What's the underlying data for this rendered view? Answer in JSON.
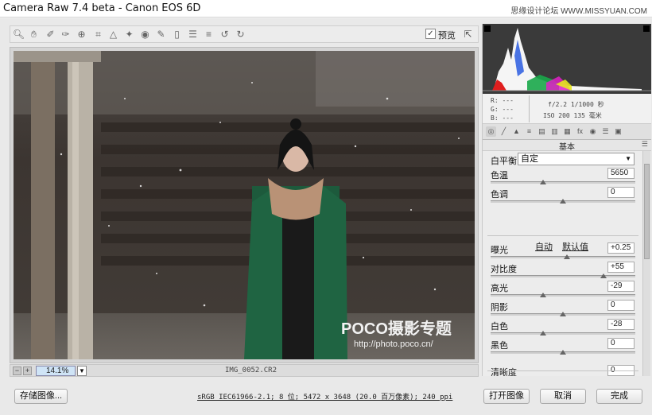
{
  "window": {
    "title": "Camera Raw 7.4 beta -  Canon EOS 6D",
    "watermark": "思缘设计论坛  WWW.MISSYUAN.COM"
  },
  "toolbar": {
    "tools": [
      "zoom-icon",
      "hand-icon",
      "white-balance-icon",
      "color-sampler-icon",
      "target-adjust-icon",
      "crop-icon",
      "straighten-icon",
      "spot-removal-icon",
      "red-eye-icon",
      "adjustment-brush-icon",
      "graduated-filter-icon",
      "radial-filter-icon",
      "preferences-icon",
      "rotate-ccw-icon",
      "rotate-cw-icon"
    ],
    "preview_label": "预览",
    "preview_checked": true
  },
  "image": {
    "watermark_brand": "POCO摄影专题",
    "watermark_url": "http://photo.poco.cn/"
  },
  "zoom": {
    "value": "14.1%",
    "filename": "IMG_0052.CR2"
  },
  "footer": {
    "save_label": "存储图像...",
    "workflow_info": "sRGB IEC61966-2.1; 8 位; 5472 x 3648 (20.0 百万像素); 240 ppi",
    "open_label": "打开图像",
    "cancel_label": "取消",
    "done_label": "完成"
  },
  "readout": {
    "r": "R:  ---",
    "g": "G:  ---",
    "b": "B:  ---",
    "aperture_shutter": "f/2.2  1/1000 秒",
    "iso_focal": "ISO 200  135 毫米"
  },
  "panel": {
    "section_title": "基本",
    "white_balance_label": "白平衡:",
    "white_balance_value": "自定",
    "auto_label": "自动",
    "default_label": "默认值",
    "sliders": [
      {
        "label": "色温",
        "value": "5650",
        "pos": 0.36
      },
      {
        "label": "色调",
        "value": "0",
        "pos": 0.5
      },
      {
        "label": "曝光",
        "value": "+0.25",
        "pos": 0.53
      },
      {
        "label": "对比度",
        "value": "+55",
        "pos": 0.78
      },
      {
        "label": "高光",
        "value": "-29",
        "pos": 0.36
      },
      {
        "label": "阴影",
        "value": "0",
        "pos": 0.5
      },
      {
        "label": "白色",
        "value": "-28",
        "pos": 0.36
      },
      {
        "label": "黑色",
        "value": "0",
        "pos": 0.5
      },
      {
        "label": "清晰度",
        "value": "0",
        "pos": 0.5
      }
    ]
  }
}
